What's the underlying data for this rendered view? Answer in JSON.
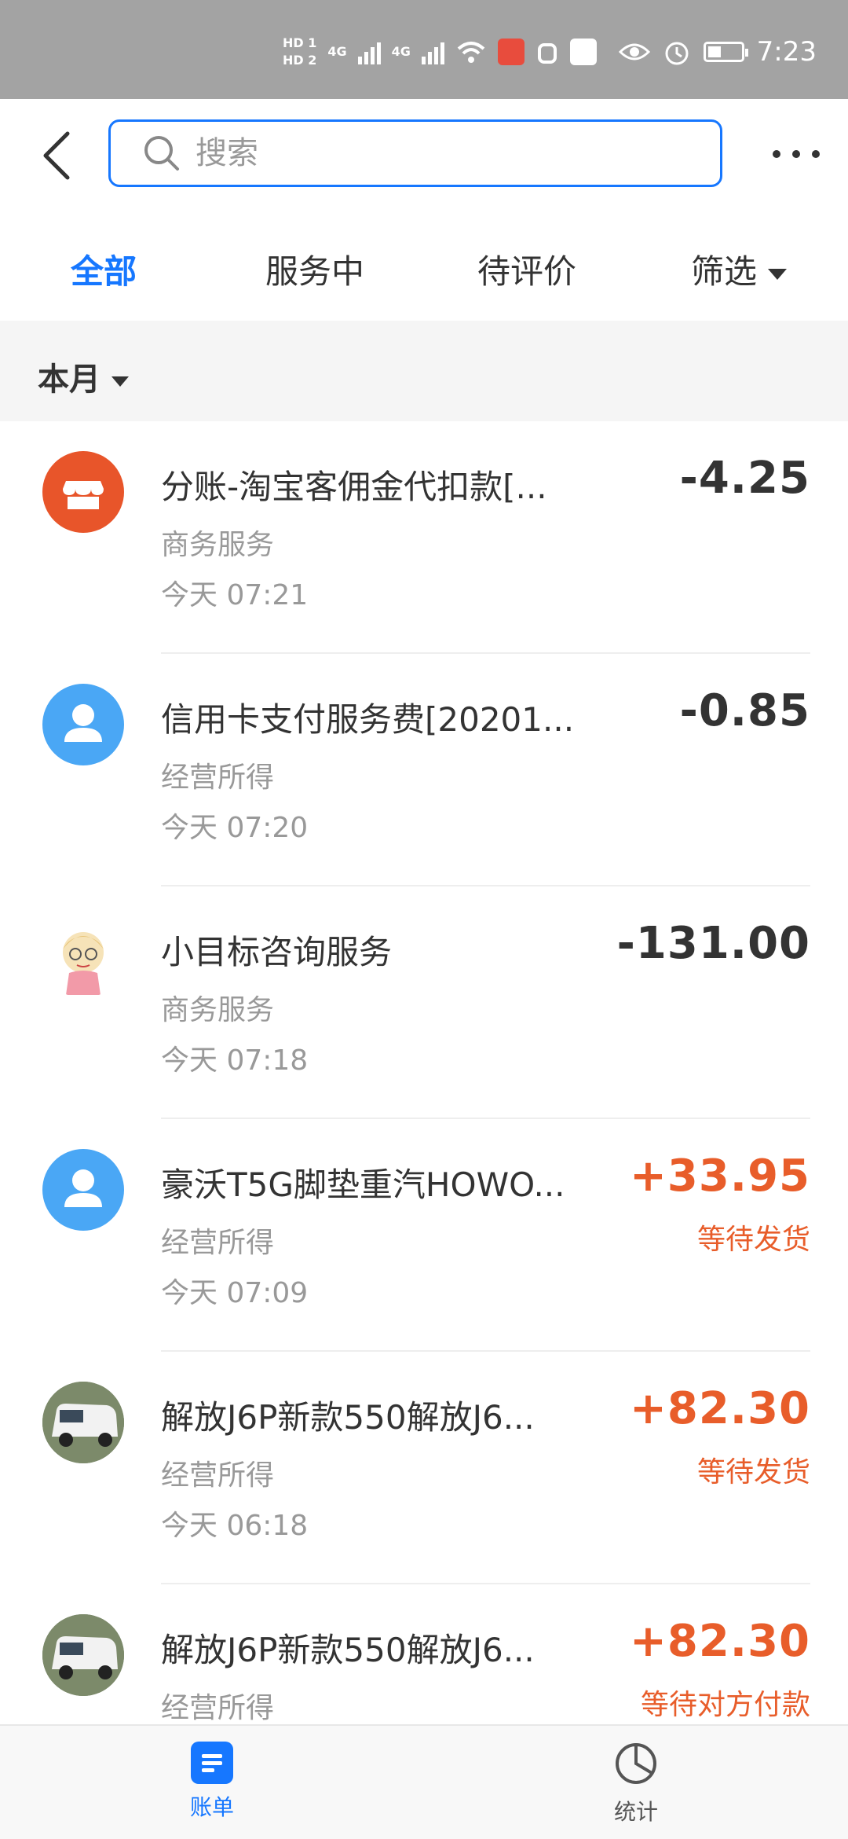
{
  "status_bar": {
    "indicators": [
      "HD 1",
      "HD 2",
      "4G",
      "4G"
    ],
    "time": "7:23"
  },
  "header": {
    "search_placeholder": "搜索"
  },
  "tabs": [
    {
      "label": "全部",
      "active": true
    },
    {
      "label": "服务中",
      "active": false
    },
    {
      "label": "待评价",
      "active": false
    },
    {
      "label": "筛选",
      "active": false
    }
  ],
  "month_filter": "本月",
  "transactions": [
    {
      "title": "分账-淘宝客佣金代扣款[...",
      "category": "商务服务",
      "time": "今天  07:21",
      "amount": "-4.25",
      "status": "",
      "avatar": "store-icon"
    },
    {
      "title": "信用卡支付服务费[20201...",
      "category": "经营所得",
      "time": "今天  07:20",
      "amount": "-0.85",
      "status": "",
      "avatar": "person-icon"
    },
    {
      "title": "小目标咨询服务",
      "category": "商务服务",
      "time": "今天  07:18",
      "amount": "-131.00",
      "status": "",
      "avatar": "cartoon-avatar"
    },
    {
      "title": "豪沃T5G脚垫重汽HOWO...",
      "category": "经营所得",
      "time": "今天  07:09",
      "amount": "+33.95",
      "status": "等待发货",
      "avatar": "person-icon"
    },
    {
      "title": "解放J6P新款550解放J6...",
      "category": "经营所得",
      "time": "今天  06:18",
      "amount": "+82.30",
      "status": "等待发货",
      "avatar": "police-car-photo"
    },
    {
      "title": "解放J6P新款550解放J6...",
      "category": "经营所得",
      "time": "",
      "amount": "+82.30",
      "status": "等待对方付款",
      "avatar": "police-car-photo"
    }
  ],
  "bottom_tabs": [
    {
      "label": "账单",
      "active": true
    },
    {
      "label": "统计",
      "active": false
    }
  ],
  "colors": {
    "accent": "#1677ff",
    "income": "#e85d2a",
    "store_avatar": "#e8552a",
    "person_avatar": "#4aa7f5"
  }
}
